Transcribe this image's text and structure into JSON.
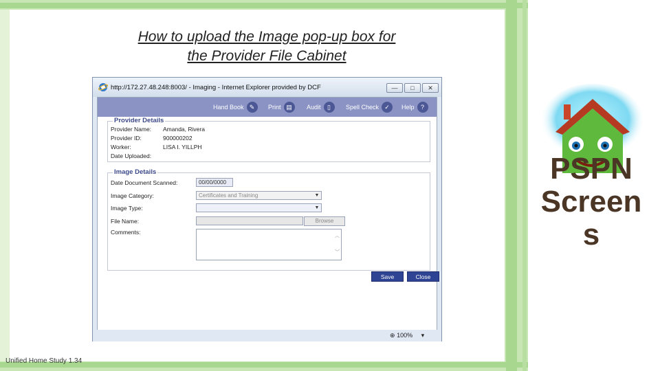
{
  "slide": {
    "title_line1": "How to upload the Image pop-up box for",
    "title_line2": "the Provider File Cabinet",
    "footer": "Unified Home Study 1.34",
    "logo_text_line1": "PSPN",
    "logo_text_line2": "Screen",
    "logo_text_line3": "s"
  },
  "window": {
    "title": "http://172.27.48.248:8003/ - Imaging - Internet Explorer provided by DCF",
    "minimize_glyph": "—",
    "maximize_glyph": "□",
    "close_glyph": "✕",
    "zoom": "100%",
    "zoom_arrow": "▾"
  },
  "toolbar": {
    "handbook": "Hand Book",
    "print": "Print",
    "audit": "Audit",
    "spellcheck": "Spell Check",
    "help": "Help",
    "help_glyph": "?"
  },
  "provider_details": {
    "legend": "Provider Details",
    "name_label": "Provider Name:",
    "name_value": "Amanda, Rivera",
    "id_label": "Provider ID:",
    "id_value": "900000202",
    "worker_label": "Worker:",
    "worker_value": "LISA I. YILLPH",
    "date_label": "Date Uploaded:",
    "date_value": ""
  },
  "image_details": {
    "legend": "Image Details",
    "scanned_label": "Date Document Scanned:",
    "scanned_value": "00/00/0000",
    "category_label": "Image Category:",
    "category_value": "Certificates and Training",
    "type_label": "Image Type:",
    "type_value": "",
    "file_label": "File Name:",
    "file_value": "",
    "browse_label": "Browse",
    "comments_label": "Comments:"
  },
  "actions": {
    "save": "Save",
    "close": "Close"
  },
  "colors": {
    "toolbar": "#8a93c4",
    "legend_text": "#3d4a8a",
    "button": "#2e4393",
    "frame_green": "#c8e6b4",
    "logo_text": "#4b3626"
  }
}
